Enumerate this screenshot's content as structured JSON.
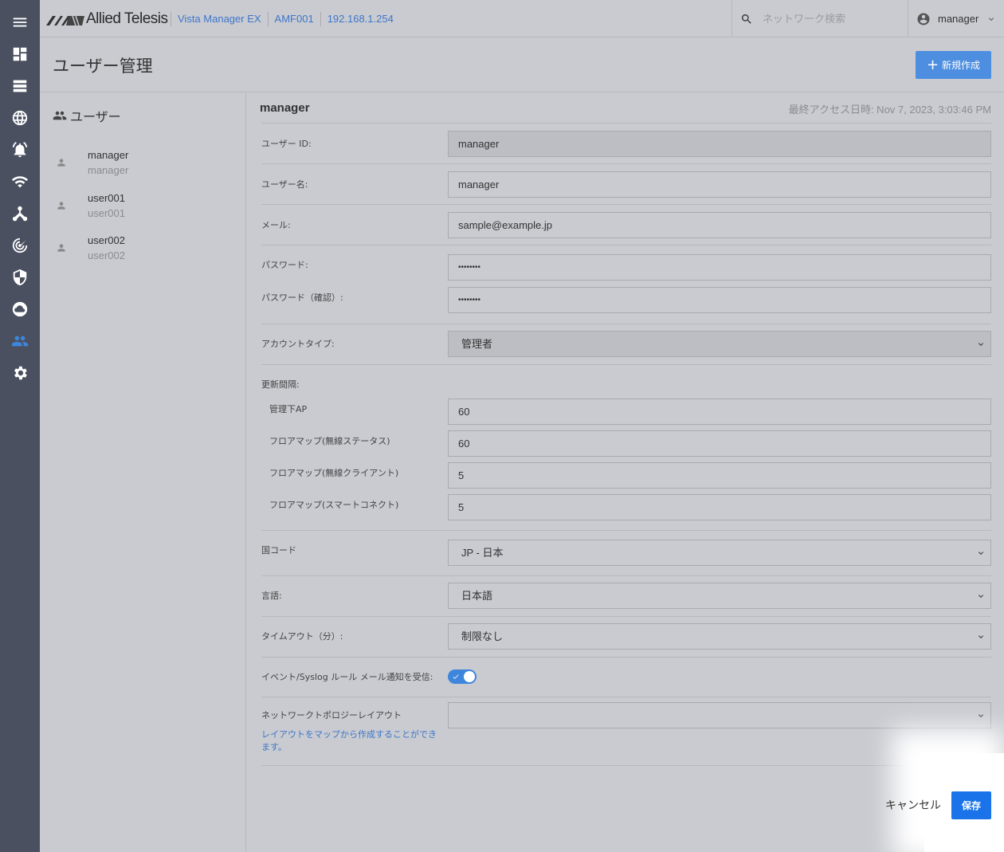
{
  "brand": {
    "logo_text": "Allied Telesis"
  },
  "breadcrumbs": [
    "Vista Manager EX",
    "AMF001",
    "192.168.1.254"
  ],
  "search": {
    "placeholder": "ネットワーク検索"
  },
  "user_menu": {
    "name": "manager"
  },
  "page": {
    "title": "ユーザー管理",
    "new_button": "新規作成"
  },
  "users_panel": {
    "heading": "ユーザー",
    "items": [
      {
        "id": "manager",
        "name": "manager"
      },
      {
        "id": "user001",
        "name": "user001"
      },
      {
        "id": "user002",
        "name": "user002"
      }
    ]
  },
  "form": {
    "header_name": "manager",
    "last_access": "最終アクセス日時: Nov 7, 2023, 3:03:46 PM",
    "user_id_label": "ユーザー ID:",
    "user_id_value": "manager",
    "username_label": "ユーザー名:",
    "username_value": "manager",
    "email_label": "メール:",
    "email_value": "sample@example.jp",
    "password_label": "パスワード:",
    "password_value": "••••••••",
    "password_confirm_label": "パスワード（確認）:",
    "password_confirm_value": "••••••••",
    "account_type_label": "アカウントタイプ:",
    "account_type_value": "管理者",
    "refresh_label": "更新間隔:",
    "refresh_ap_label": "管理下AP",
    "refresh_ap_value": "60",
    "refresh_wireless_status_label": "フロアマップ(無線ステータス)",
    "refresh_wireless_status_value": "60",
    "refresh_wireless_client_label": "フロアマップ(無線クライアント)",
    "refresh_wireless_client_value": "5",
    "refresh_smart_connect_label": "フロアマップ(スマートコネクト)",
    "refresh_smart_connect_value": "5",
    "country_label": "国コード",
    "country_value": "JP - 日本",
    "language_label": "言語:",
    "language_value": "日本語",
    "timeout_label": "タイムアウト（分）:",
    "timeout_value": "制限なし",
    "notify_label": "イベント/Syslog ルール メール通知を受信:",
    "notify_on": true,
    "topology_label": "ネットワークトポロジーレイアウト",
    "topology_value": "",
    "topology_hint": "レイアウトをマップから作成することができます。"
  },
  "actions": {
    "cancel": "キャンセル",
    "save": "保存"
  },
  "colors": {
    "accent": "#3e86dc",
    "primary_button": "#1a73e8",
    "sidebar": "#4a5060"
  }
}
